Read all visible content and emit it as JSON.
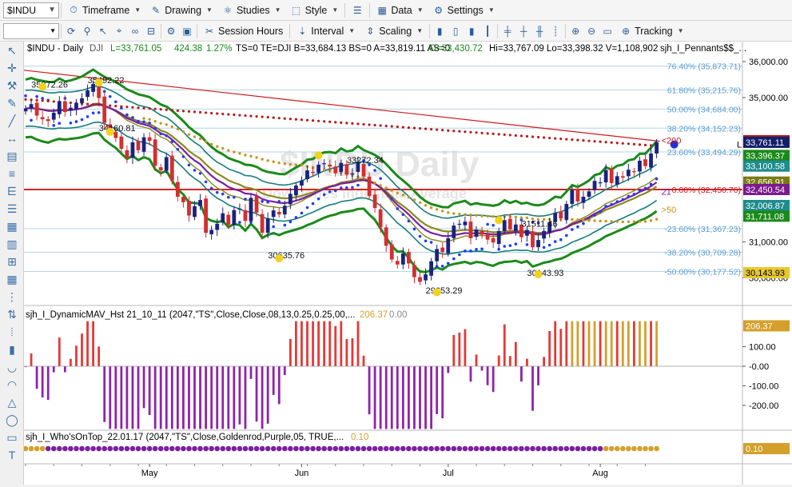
{
  "toolbar1": {
    "symbol": "$INDU",
    "timeframe": "Timeframe",
    "drawing": "Drawing",
    "studies": "Studies",
    "style": "Style",
    "data": "Data",
    "settings": "Settings"
  },
  "toolbar2": {
    "session_hours": "Session Hours",
    "interval": "Interval",
    "scaling": "Scaling",
    "tracking": "Tracking"
  },
  "header": {
    "symbol": "$INDU - Daily",
    "exchange": "DJI",
    "last": "L=33,761.05",
    "change": "424.38",
    "pct": "1.27%",
    "rest": "TS=0  TE=DJI  B=33,684.13  BS=0  A=33,819.11  AS=0",
    "open": "O=33,430.72",
    "hilo": "Hi=33,767.09  Lo=33,398.32  V=1,108,902",
    "study": "sjh_I_Pennants$$_..."
  },
  "watermark": {
    "title": "$INDU Daily",
    "subtitle": "Dow Jones Industrial Average"
  },
  "fib_labels": [
    {
      "text": "76.40% (35,873.71)",
      "price": 35873.71
    },
    {
      "text": "61.80% (35,215.76)",
      "price": 35215.76
    },
    {
      "text": "50.00% (34,684.00)",
      "price": 34684.0
    },
    {
      "text": "38.20% (34,152.23)",
      "price": 34152.23
    },
    {
      "text": "23.60% (33,494.29)",
      "price": 33494.29
    },
    {
      "text": "0.00% (32,450.76)",
      "price": 32450.76
    },
    {
      "text": "-23.60% (31,367.23)",
      "price": 31367.23
    },
    {
      "text": "-38.20% (30,709.28)",
      "price": 30709.28
    },
    {
      "text": "-50.00% (30,177.52)",
      "price": 30177.52
    }
  ],
  "price_annotations": [
    {
      "text": "35372.26",
      "idx": 3,
      "price": 35372.26
    },
    {
      "text": "35492.22",
      "idx": 13,
      "price": 35492.22
    },
    {
      "text": "34160.81",
      "idx": 15,
      "price": 34160.81
    },
    {
      "text": "30635.76",
      "idx": 45,
      "price": 30635.76
    },
    {
      "text": "33272.34",
      "idx": 59,
      "price": 33272.34
    },
    {
      "text": "29653.29",
      "idx": 73,
      "price": 29653.29
    },
    {
      "text": "31511.46",
      "idx": 90,
      "price": 31511.46
    },
    {
      "text": "30143.93",
      "idx": 91,
      "price": 30143.93
    }
  ],
  "ma_labels": {
    "ma200": "<200",
    "ma21": "21",
    "ma50": ">50",
    "l": "L"
  },
  "price_axis": {
    "ticks": [
      "36,000.00",
      "35,000.00",
      "31,000.00",
      "30,000.00"
    ],
    "tick_values": [
      36000,
      35000,
      31000,
      30000
    ],
    "badges": [
      {
        "text": "33,805.93",
        "price": 33805.93,
        "bg": "#b01c1c",
        "fg": "#ffffff"
      },
      {
        "text": "33,761.11",
        "price": 33761.11,
        "bg": "#13206a",
        "fg": "#ffffff"
      },
      {
        "text": "33,396.37",
        "price": 33396.37,
        "bg": "#1a8a1a",
        "fg": "#ffffff"
      },
      {
        "text": "33,100.58",
        "price": 33100.58,
        "bg": "#1e8c8c",
        "fg": "#ffffff"
      },
      {
        "text": "32,656.91",
        "price": 32656.91,
        "bg": "#7a7a14",
        "fg": "#ffffff"
      },
      {
        "text": "32,450.54",
        "price": 32450.54,
        "bg": "#7b1a8c",
        "fg": "#ffffff"
      },
      {
        "text": "32,006.87",
        "price": 32006.87,
        "bg": "#1e8c8c",
        "fg": "#ffffff"
      },
      {
        "text": "31,711.08",
        "price": 31711.08,
        "bg": "#1a8a1a",
        "fg": "#ffffff"
      },
      {
        "text": "30,143.93",
        "price": 30143.93,
        "bg": "#e8c830",
        "fg": "#000000"
      }
    ]
  },
  "study1": {
    "title": "sjh_I_DynamicMAV_Hst 21_10_11 (2047,\"TS\",Close,Close,08,13,0.25,0.25,00,...",
    "val1": "206.37",
    "val2": "0.00",
    "axis_ticks": [
      "100.00",
      "-0.00",
      "-100.00",
      "-200.00"
    ],
    "badge": "206.37"
  },
  "study2": {
    "title": "sjh_I_Who'sOnTop_22.01.17 (2047,\"TS\",Close,Goldenrod,Purple,05, TRUE,...",
    "val": "0.10",
    "badge": "0.10"
  },
  "months": [
    "May",
    "Jun",
    "Jul",
    "Aug"
  ],
  "colors": {
    "up": "#1a237e",
    "down": "#d32f2f",
    "ma200": "#b71c1c",
    "band_outer": "#1b8a1b",
    "band_inner": "#167c7c",
    "ma21": "#7b1fa2",
    "gold": "#8a8a1c",
    "blue_dots": "#1e3cff",
    "ochre_dots": "#c8961e",
    "hist_red": "#e53935",
    "hist_gold": "#d4a02a",
    "hist_purple": "#8e24aa",
    "hist_green": "#2e8b2e"
  },
  "chart_data": {
    "type": "candlestick",
    "title": "$INDU Daily",
    "y_range": [
      29500,
      36200
    ],
    "closes": [
      34700,
      34820,
      34500,
      34400,
      34350,
      34580,
      34900,
      34600,
      34720,
      34850,
      34980,
      35200,
      35380,
      34990,
      34300,
      34050,
      33880,
      33580,
      33330,
      33760,
      33540,
      33900,
      33800,
      33110,
      32980,
      33350,
      32700,
      32250,
      32100,
      31730,
      31990,
      32160,
      31250,
      31330,
      31500,
      31790,
      31470,
      31880,
      31920,
      31580,
      32220,
      31810,
      31250,
      31650,
      31870,
      31760,
      32000,
      32330,
      32560,
      32700,
      32980,
      32910,
      33140,
      33180,
      33090,
      32900,
      33190,
      32870,
      32900,
      33200,
      32810,
      32270,
      31940,
      31400,
      30890,
      30510,
      30370,
      30680,
      30400,
      30020,
      29890,
      30100,
      30460,
      30800,
      30720,
      31100,
      31450,
      31500,
      31560,
      31100,
      31340,
      31200,
      31060,
      30980,
      31300,
      31600,
      31340,
      31480,
      31130,
      31330,
      30850,
      31050,
      31300,
      31550,
      31800,
      31650,
      32050,
      32430,
      32120,
      32250,
      32400,
      32690,
      32650,
      32990,
      32630,
      32820,
      32780,
      33000,
      32950,
      33250,
      33100,
      33450,
      33760
    ]
  }
}
